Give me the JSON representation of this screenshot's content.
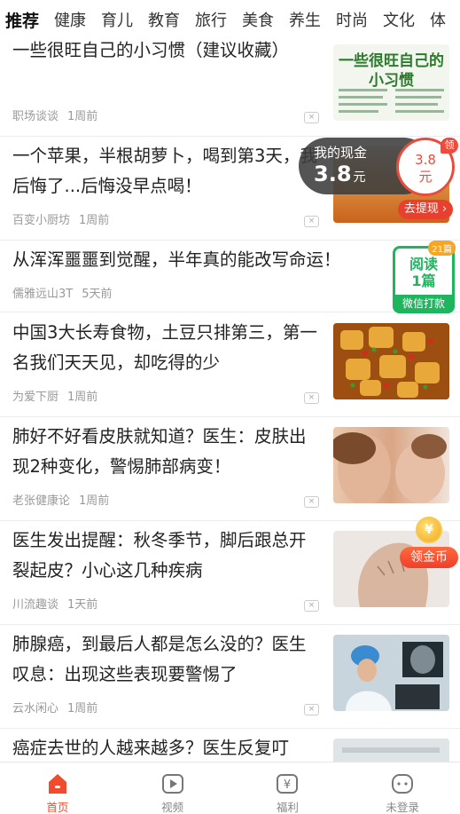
{
  "tabs": [
    "推荐",
    "健康",
    "育儿",
    "教育",
    "旅行",
    "美食",
    "养生",
    "时尚",
    "文化",
    "体"
  ],
  "articles": [
    {
      "title": "一些很旺自己的小习惯（建议收藏）",
      "source": "职场谈谈",
      "time": "1周前",
      "thumb_text": "一些很旺自己的小习惯"
    },
    {
      "title": "一个苹果，半根胡萝卜，喝到第3天，我后悔了...后悔没早点喝！",
      "source": "百变小厨坊",
      "time": "1周前"
    },
    {
      "title": "从浑浑噩噩到觉醒，半年真的能改写命运！",
      "source": "儒雅远山3T",
      "time": "5天前"
    },
    {
      "title": "中国3大长寿食物，土豆只排第三，第一名我们天天见，却吃得的少",
      "source": "为爱下厨",
      "time": "1周前"
    },
    {
      "title": "肺好不好看皮肤就知道？医生：皮肤出现2种变化，警惕肺部病变！",
      "source": "老张健康论",
      "time": "1周前"
    },
    {
      "title": "医生发出提醒：秋冬季节，脚后跟总开裂起皮？小心这几种疾病",
      "source": "川流趣谈",
      "time": "1天前"
    },
    {
      "title": "肺腺癌，到最后人都是怎么没的？医生叹息：出现这些表现要警惕了",
      "source": "云水闲心",
      "time": "1周前"
    },
    {
      "title": "癌症去世的人越来越多？医生反复叮",
      "source": "",
      "time": ""
    }
  ],
  "cash_widget": {
    "label": "我的现金",
    "amount": "3.8",
    "unit": "元",
    "coin_value": "3.8",
    "coin_unit": "元",
    "tag": "领",
    "withdraw": "去提现 ›"
  },
  "read_badge": {
    "line1": "阅读",
    "line2": "1篇",
    "footer": "微信打款",
    "count": "21篇"
  },
  "coin_badge": {
    "symbol": "¥",
    "label": "领金币"
  },
  "close_mark": "×",
  "bottom_nav": [
    {
      "label": "首页",
      "icon": "home-icon",
      "active": true
    },
    {
      "label": "视频",
      "icon": "video-play-icon",
      "active": false
    },
    {
      "label": "福利",
      "icon": "yuan-wallet-icon",
      "active": false
    },
    {
      "label": "未登录",
      "icon": "user-face-icon",
      "active": false
    }
  ],
  "colors": {
    "accent": "#e8502f",
    "green": "#1fb45e",
    "text": "#222222",
    "meta": "#999999"
  }
}
